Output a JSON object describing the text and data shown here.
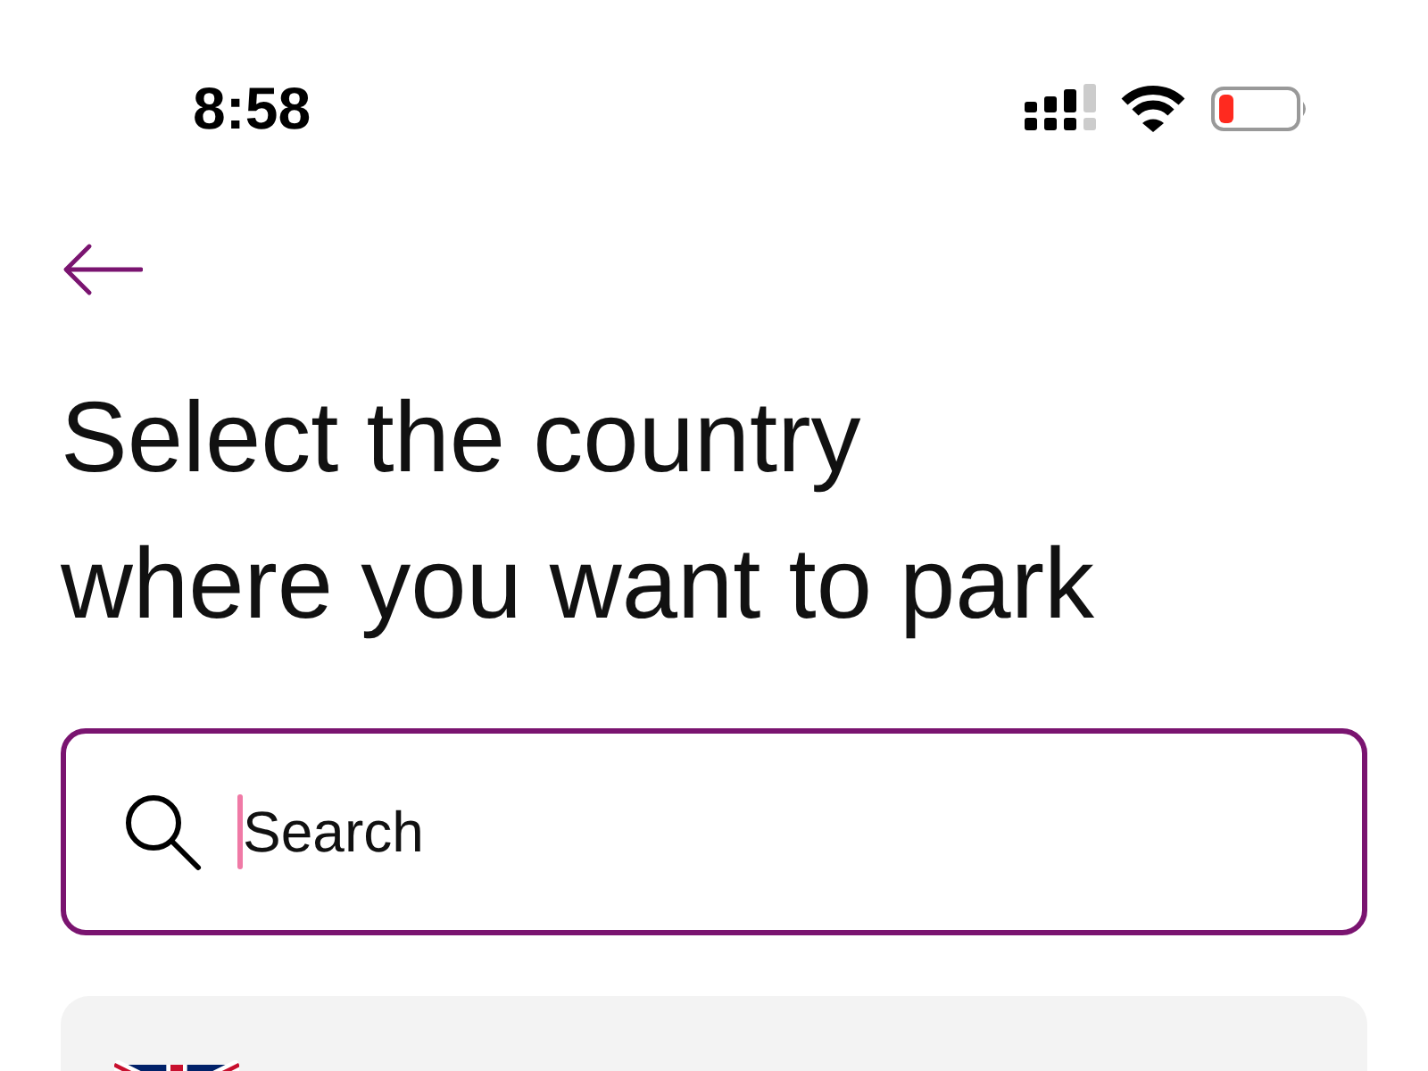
{
  "status_bar": {
    "time": "8:58"
  },
  "title": "Select the country where you want to park",
  "search": {
    "placeholder": "Search"
  },
  "countries": [
    {
      "kind": "uk"
    }
  ]
}
